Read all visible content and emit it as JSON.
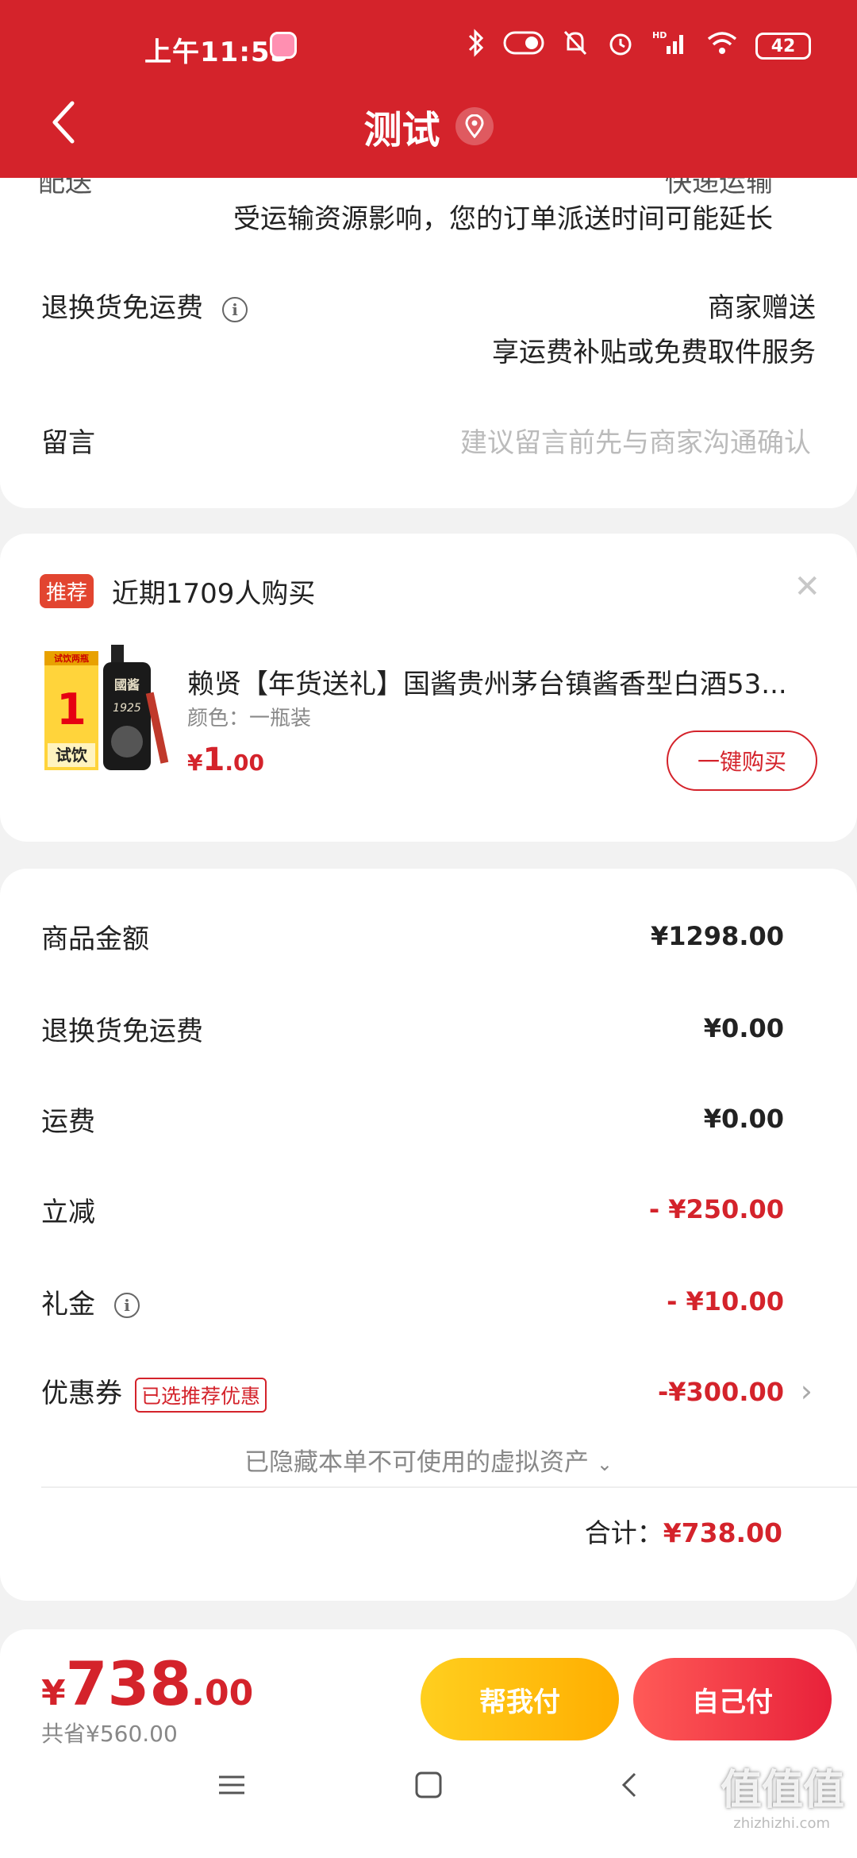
{
  "status_bar": {
    "time": "上午11:53",
    "hd": "HD",
    "battery": "42"
  },
  "header": {
    "title": "测试"
  },
  "shipping": {
    "partial_label": "配送",
    "partial_value": "快递运输",
    "note": "受运输资源影响，您的订单派送时间可能延长",
    "return_label": "退换货免运费",
    "return_value1": "商家赠送",
    "return_value2": "享运费补贴或免费取件服务",
    "message_label": "留言",
    "message_placeholder": "建议留言前先与商家沟通确认"
  },
  "recommend": {
    "tag": "推荐",
    "headline": "近期1709人购买",
    "product_title": "赖贤【年货送礼】国酱贵州茅台镇酱香型白酒53...",
    "spec": "颜色：一瓶装",
    "price_symbol": "¥",
    "price_int": "1",
    "price_dec": ".00",
    "buy_label": "一键购买",
    "img_text_top": "试饮两瓶",
    "img_text_price": "1",
    "img_text_bottom": "试饮",
    "bottle_text": "國酱",
    "bottle_year": "1925"
  },
  "amounts": {
    "goods_label": "商品金额",
    "goods_value": "¥1298.00",
    "return_label": "退换货免运费",
    "return_value": "¥0.00",
    "freight_label": "运费",
    "freight_value": "¥0.00",
    "discount_label": "立减",
    "discount_value": "- ¥250.00",
    "gift_label": "礼金",
    "gift_value": "- ¥10.00",
    "coupon_label": "优惠券",
    "coupon_tag": "已选推荐优惠",
    "coupon_value": "-¥300.00",
    "hidden_assets": "已隐藏本单不可使用的虚拟资产",
    "total_label": "合计：",
    "total_value": "¥738.00"
  },
  "bottom_bar": {
    "price_symbol": "¥",
    "price_int": "738",
    "price_dec": ".00",
    "saved": "共省¥560.00",
    "help_pay": "帮我付",
    "self_pay": "自己付"
  },
  "watermark": {
    "main": "值值值",
    "sub": "zhizhizhi.com"
  },
  "colors": {
    "brand_red": "#d4232b",
    "help_yellow": "#ffbe10",
    "self_red": "#ef2f45"
  }
}
